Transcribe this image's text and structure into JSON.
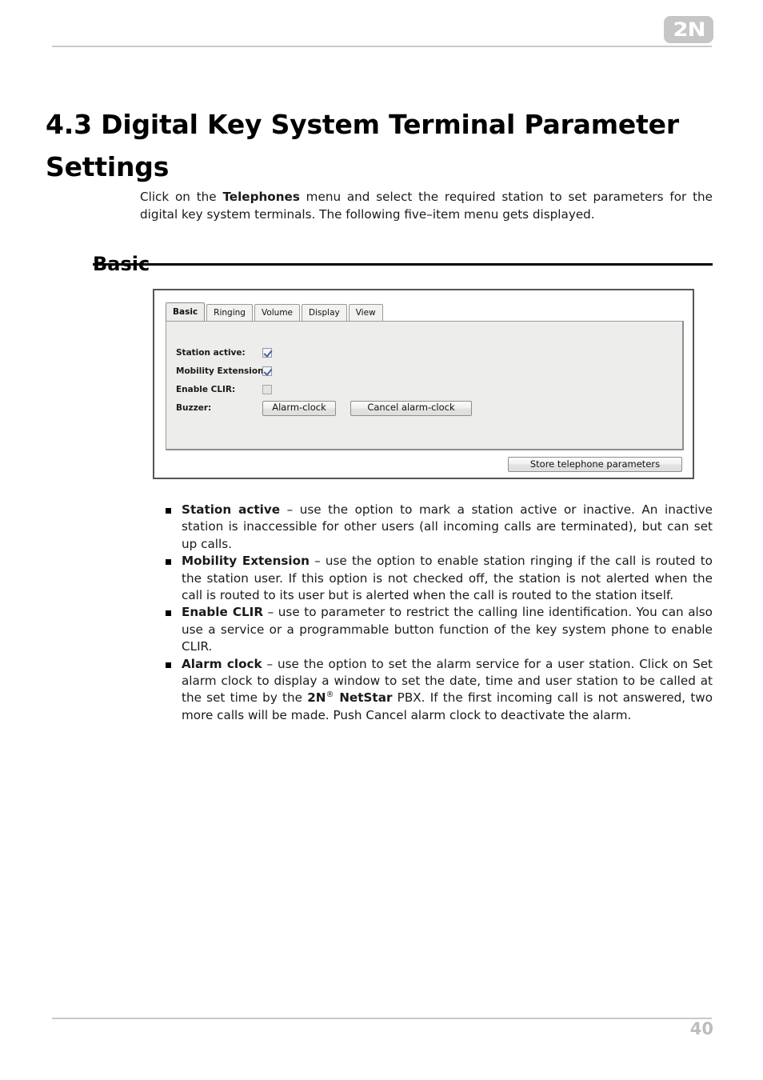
{
  "header": {
    "logo_text": "2N"
  },
  "title": "4.3 Digital Key System Terminal Parameter Settings",
  "intro": {
    "part1": "Click on the ",
    "bold1": "Telephones",
    "part2": " menu and select the required station to set parameters for the digital key system terminals. The following five–item menu gets displayed."
  },
  "section": {
    "heading": "Basic"
  },
  "app": {
    "tabs": [
      {
        "label": "Basic",
        "active": true
      },
      {
        "label": "Ringing",
        "active": false
      },
      {
        "label": "Volume",
        "active": false
      },
      {
        "label": "Display",
        "active": false
      },
      {
        "label": "View",
        "active": false
      }
    ],
    "fields": [
      {
        "label": "Station active:",
        "type": "checkbox",
        "checked": true
      },
      {
        "label": "Mobility Extension:",
        "type": "checkbox",
        "checked": true
      },
      {
        "label": "Enable CLIR:",
        "type": "checkbox",
        "checked": false
      },
      {
        "label": "Buzzer:",
        "type": "buttons"
      }
    ],
    "buttons": {
      "alarm_clock": "Alarm-clock",
      "cancel_alarm_clock": "Cancel alarm-clock",
      "store": "Store telephone parameters"
    }
  },
  "bullets": [
    {
      "term": "Station active",
      "text": " – use the option to mark a station active or inactive. An inactive station is inaccessible for other users (all incoming calls are terminated), but can set up calls."
    },
    {
      "term": "Mobility Extension",
      "text": " – use the option to enable station ringing if the call is routed to the station user. If this option is not checked off, the station is not alerted when the call is routed to its user but is alerted when the call is routed to the station itself."
    },
    {
      "term": "Enable CLIR",
      "text": " – use to parameter to restrict the calling line identification. You can also use a service or a programmable button function of the key system phone to enable CLIR."
    },
    {
      "term": "Alarm clock",
      "text_before": " – use the option to set the alarm service for a user station. Click on Set alarm clock to display a window to set the date, time and user station to be called at the set time by the ",
      "brand": "2N",
      "brand_sup": "®",
      "brand2": " NetStar",
      "text_after": " PBX. If the first incoming call is not answered, two more calls will be made. Push Cancel alarm clock to deactivate the alarm."
    }
  ],
  "footer": {
    "page_number": "40"
  }
}
